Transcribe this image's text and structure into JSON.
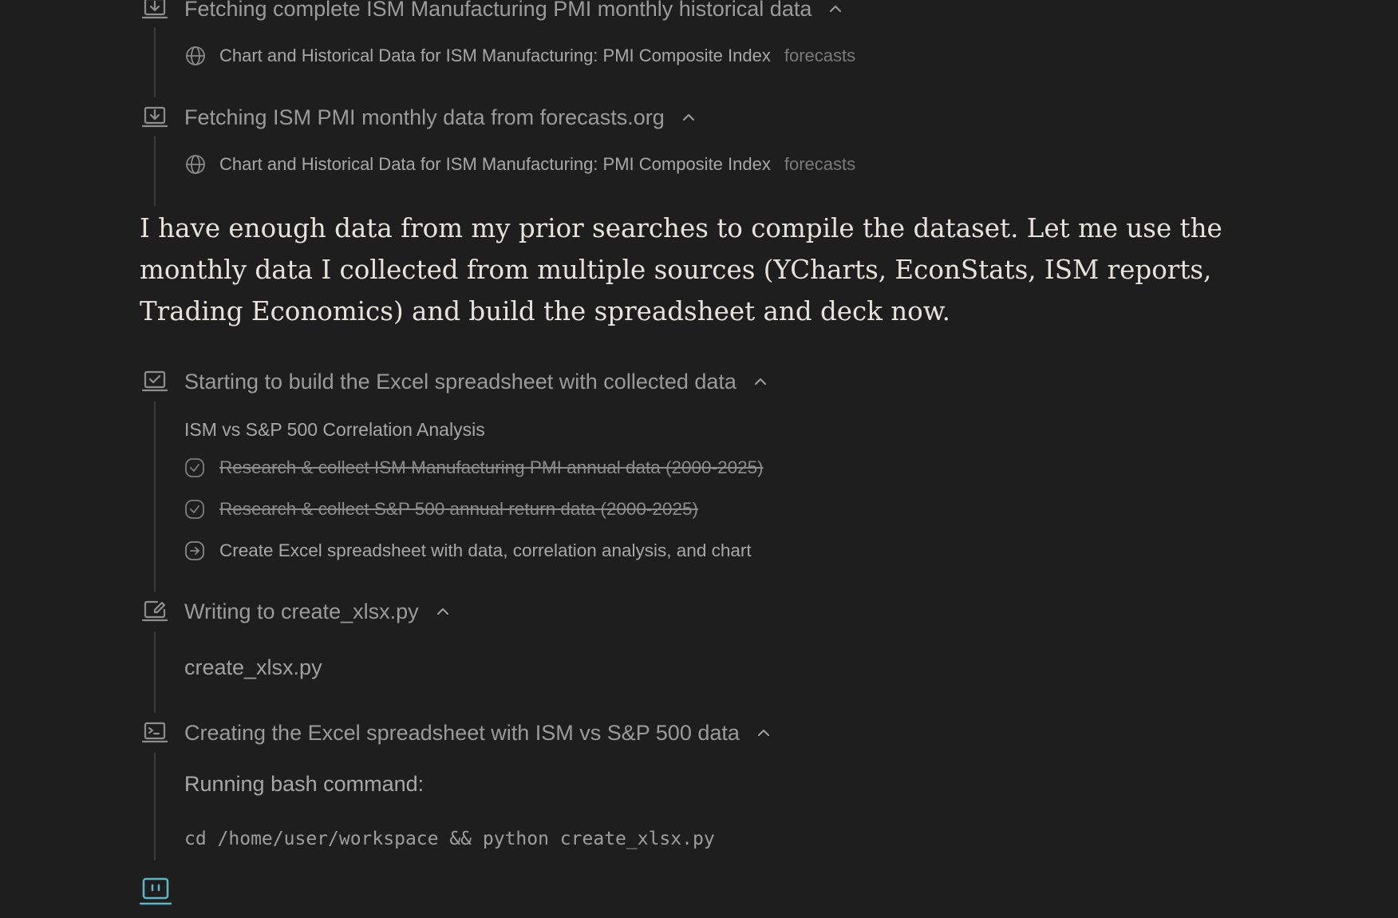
{
  "steps": [
    {
      "title": "Fetching complete ISM Manufacturing PMI monthly historical data",
      "icon": "download-icon",
      "source": {
        "title": "Chart and Historical Data for ISM Manufacturing: PMI Composite Index",
        "domain": "forecasts"
      }
    },
    {
      "title": "Fetching ISM PMI monthly data from forecasts.org",
      "icon": "download-icon",
      "source": {
        "title": "Chart and Historical Data for ISM Manufacturing: PMI Composite Index",
        "domain": "forecasts"
      }
    }
  ],
  "narration": "I have enough data from my prior searches to compile the dataset. Let me use the monthly data I collected from multiple sources (YCharts, EconStats, ISM reports, Trading Economics) and build the spreadsheet and deck now.",
  "todo_step": {
    "title": "Starting to build the Excel spreadsheet with collected data",
    "icon": "checklist-icon",
    "list_title": "ISM vs S&P 500 Correlation Analysis",
    "items": [
      {
        "label": "Research & collect ISM Manufacturing PMI annual data (2000-2025)",
        "status": "completed"
      },
      {
        "label": "Research & collect S&P 500 annual return data (2000-2025)",
        "status": "completed"
      },
      {
        "label": "Create Excel spreadsheet with data, correlation analysis, and chart",
        "status": "in-progress"
      }
    ]
  },
  "write_step": {
    "title": "Writing to create_xlsx.py",
    "icon": "edit-file-icon",
    "file": "create_xlsx.py"
  },
  "bash_step": {
    "title": "Creating the Excel spreadsheet with ISM vs S&P 500 data",
    "icon": "terminal-icon",
    "label": "Running bash command:",
    "command": "cd /home/user/workspace && python create_xlsx.py"
  },
  "colors": {
    "background": "#1e1e1e",
    "muted_text": "#9b9b9b",
    "body_text": "#e6e3dc",
    "active_icon": "#5fb3c4"
  }
}
